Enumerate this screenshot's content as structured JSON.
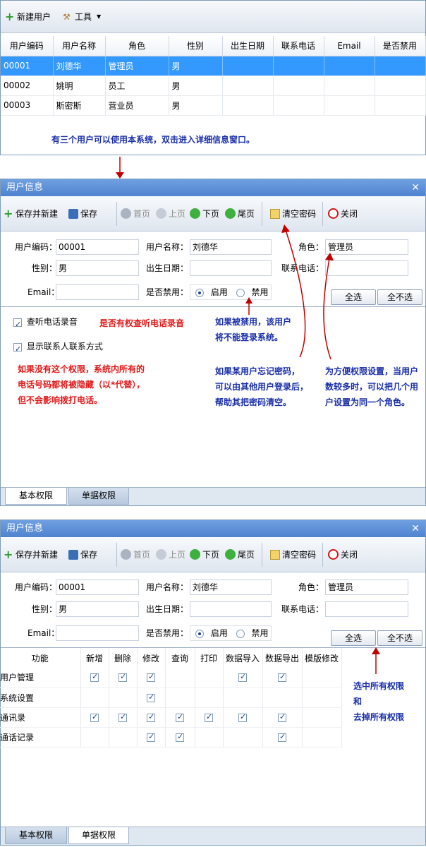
{
  "top": {
    "toolbar": {
      "new_user": "新建用户",
      "tools": "工具"
    },
    "columns": [
      "用户编码",
      "用户名称",
      "角色",
      "性别",
      "出生日期",
      "联系电话",
      "Email",
      "是否禁用"
    ],
    "rows": [
      [
        "00001",
        "刘德华",
        "管理员",
        "男",
        "",
        "",
        "",
        ""
      ],
      [
        "00002",
        "姚明",
        "员工",
        "男",
        "",
        "",
        "",
        ""
      ],
      [
        "00003",
        "斯密斯",
        "营业员",
        "男",
        "",
        "",
        "",
        ""
      ]
    ],
    "note": "有三个用户可以使用本系统，双击进入详细信息窗口。"
  },
  "dialog": {
    "title": "用户信息",
    "toolbar": {
      "save_new": "保存并新建",
      "save": "保存",
      "first": "首页",
      "prev": "上页",
      "next": "下页",
      "last": "尾页",
      "clear_pwd": "清空密码",
      "close": "关闭"
    },
    "form": {
      "code_label": "用户编码：",
      "code_value": "00001",
      "name_label": "用户名称：",
      "name_value": "刘德华",
      "role_label": "角色：",
      "role_value": "管理员",
      "gender_label": "性别：",
      "gender_value": "男",
      "birth_label": "出生日期：",
      "birth_value": "",
      "phone_label": "联系电话：",
      "phone_value": "",
      "email_label": "Email：",
      "email_value": "",
      "disabled_label": "是否禁用：",
      "enable": "启用",
      "disable": "禁用",
      "select_all": "全选",
      "select_none": "全不选"
    },
    "tabs": {
      "basic": "基本权限",
      "doc": "单据权限"
    }
  },
  "dialog1": {
    "checks": {
      "listen": "查听电话录音",
      "show_contact": "显示联系人联系方式"
    },
    "notes": {
      "listen": "是否有权查听电话录音",
      "no_perm": [
        "如果没有这个权限，系统内所有的",
        "电话号码都将被隐藏（以*代替），",
        "但不会影响拨打电话。"
      ],
      "disabled": [
        "如果被禁用，该用户",
        "将不能登录系统。"
      ],
      "forgot": [
        "如果某用户忘记密码，",
        "可以由其他用户登录后，",
        "帮助其把密码清空。"
      ],
      "role": [
        "为方便权限设置，当用户",
        "数较多时，可以把几个用",
        "户设置为同一个角色。"
      ]
    }
  },
  "dialog2": {
    "columns": [
      "功能",
      "新增",
      "删除",
      "修改",
      "查询",
      "打印",
      "数据导入",
      "数据导出",
      "模版修改"
    ],
    "rows": [
      {
        "name": "用户管理",
        "checks": [
          true,
          true,
          true,
          false,
          false,
          true,
          true,
          false
        ]
      },
      {
        "name": "系统设置",
        "checks": [
          false,
          false,
          true,
          false,
          false,
          false,
          false,
          false
        ]
      },
      {
        "name": "通讯录",
        "checks": [
          true,
          true,
          true,
          true,
          true,
          true,
          true,
          false
        ]
      },
      {
        "name": "通话记录",
        "checks": [
          false,
          false,
          true,
          true,
          false,
          false,
          true,
          false
        ]
      }
    ],
    "note": [
      "选中所有权限",
      "和",
      "去掉所有权限"
    ]
  },
  "colors": {
    "selected_row": "#3399ff",
    "title_bar": "#4f83cf",
    "note_blue": "#1a2fa8",
    "note_red": "#e01a1a",
    "arrow": "#c00000"
  }
}
